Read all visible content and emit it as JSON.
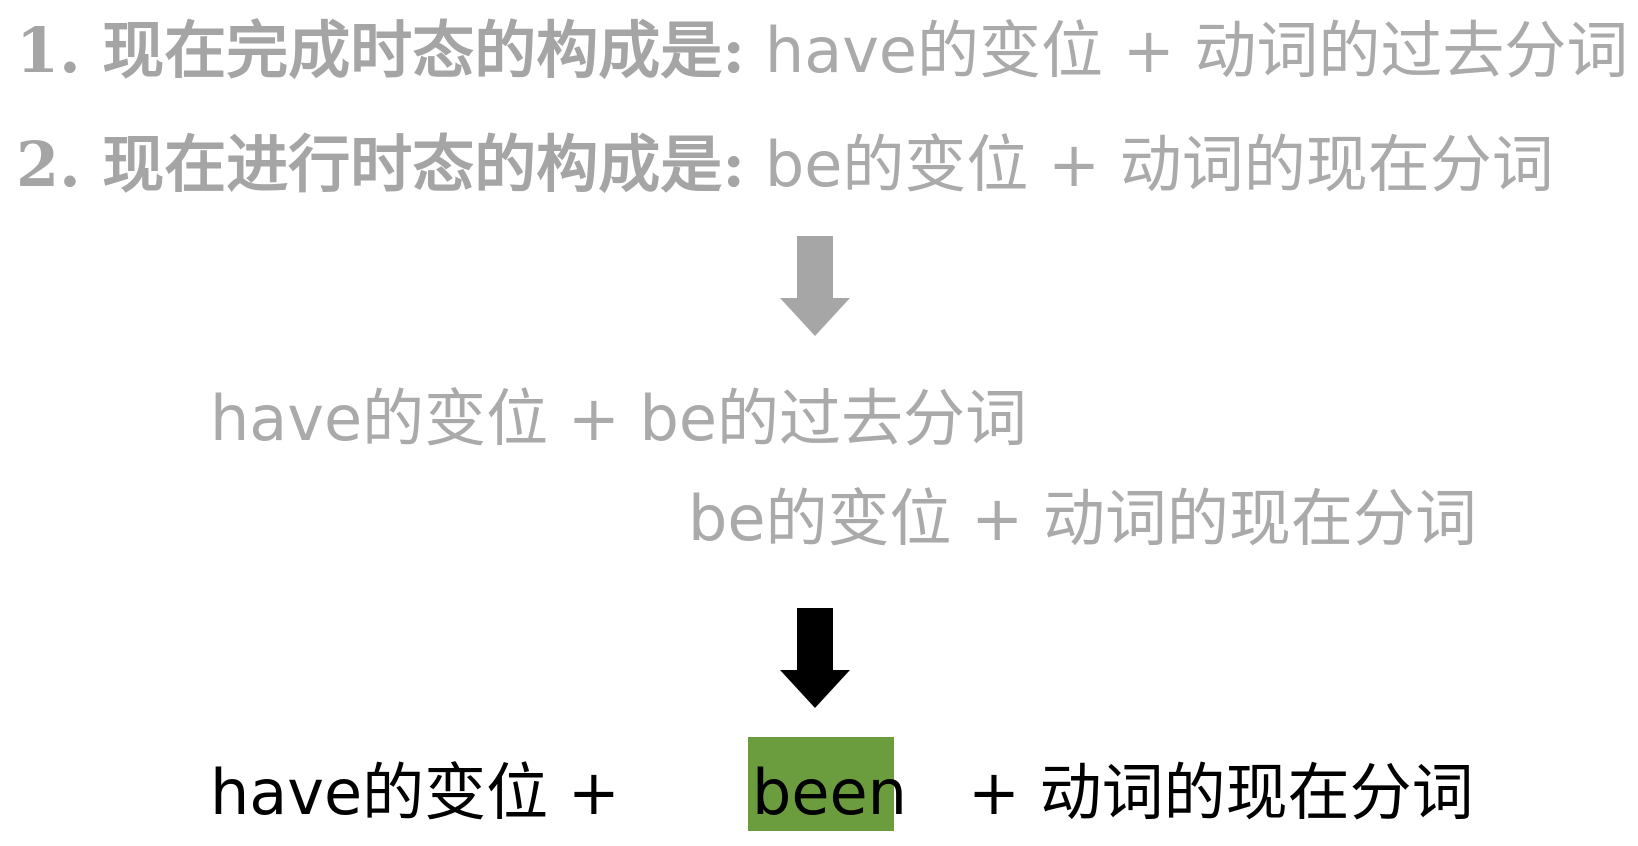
{
  "rules": [
    {
      "label": "1. 现在完成时态的构成是:",
      "content": " have的变位 + 动词的过去分词"
    },
    {
      "label": "2. 现在进行时态的构成是:",
      "content": " be的变位 + 动词的现在分词"
    }
  ],
  "derivation": {
    "line1": "have的变位 + be的过去分词",
    "line2": "be的变位 + 动词的现在分词"
  },
  "result": {
    "left": "have的变位 +",
    "highlight": "been",
    "right": "+ 动词的现在分词"
  },
  "colors": {
    "muted_text": "#aaaaaa",
    "result_text": "#000000",
    "highlight_bg": "#6b9d3f",
    "arrow_gray": "#a6a6a6",
    "arrow_black": "#000000"
  },
  "icons": [
    "down-arrow-icon",
    "down-arrow-icon"
  ]
}
